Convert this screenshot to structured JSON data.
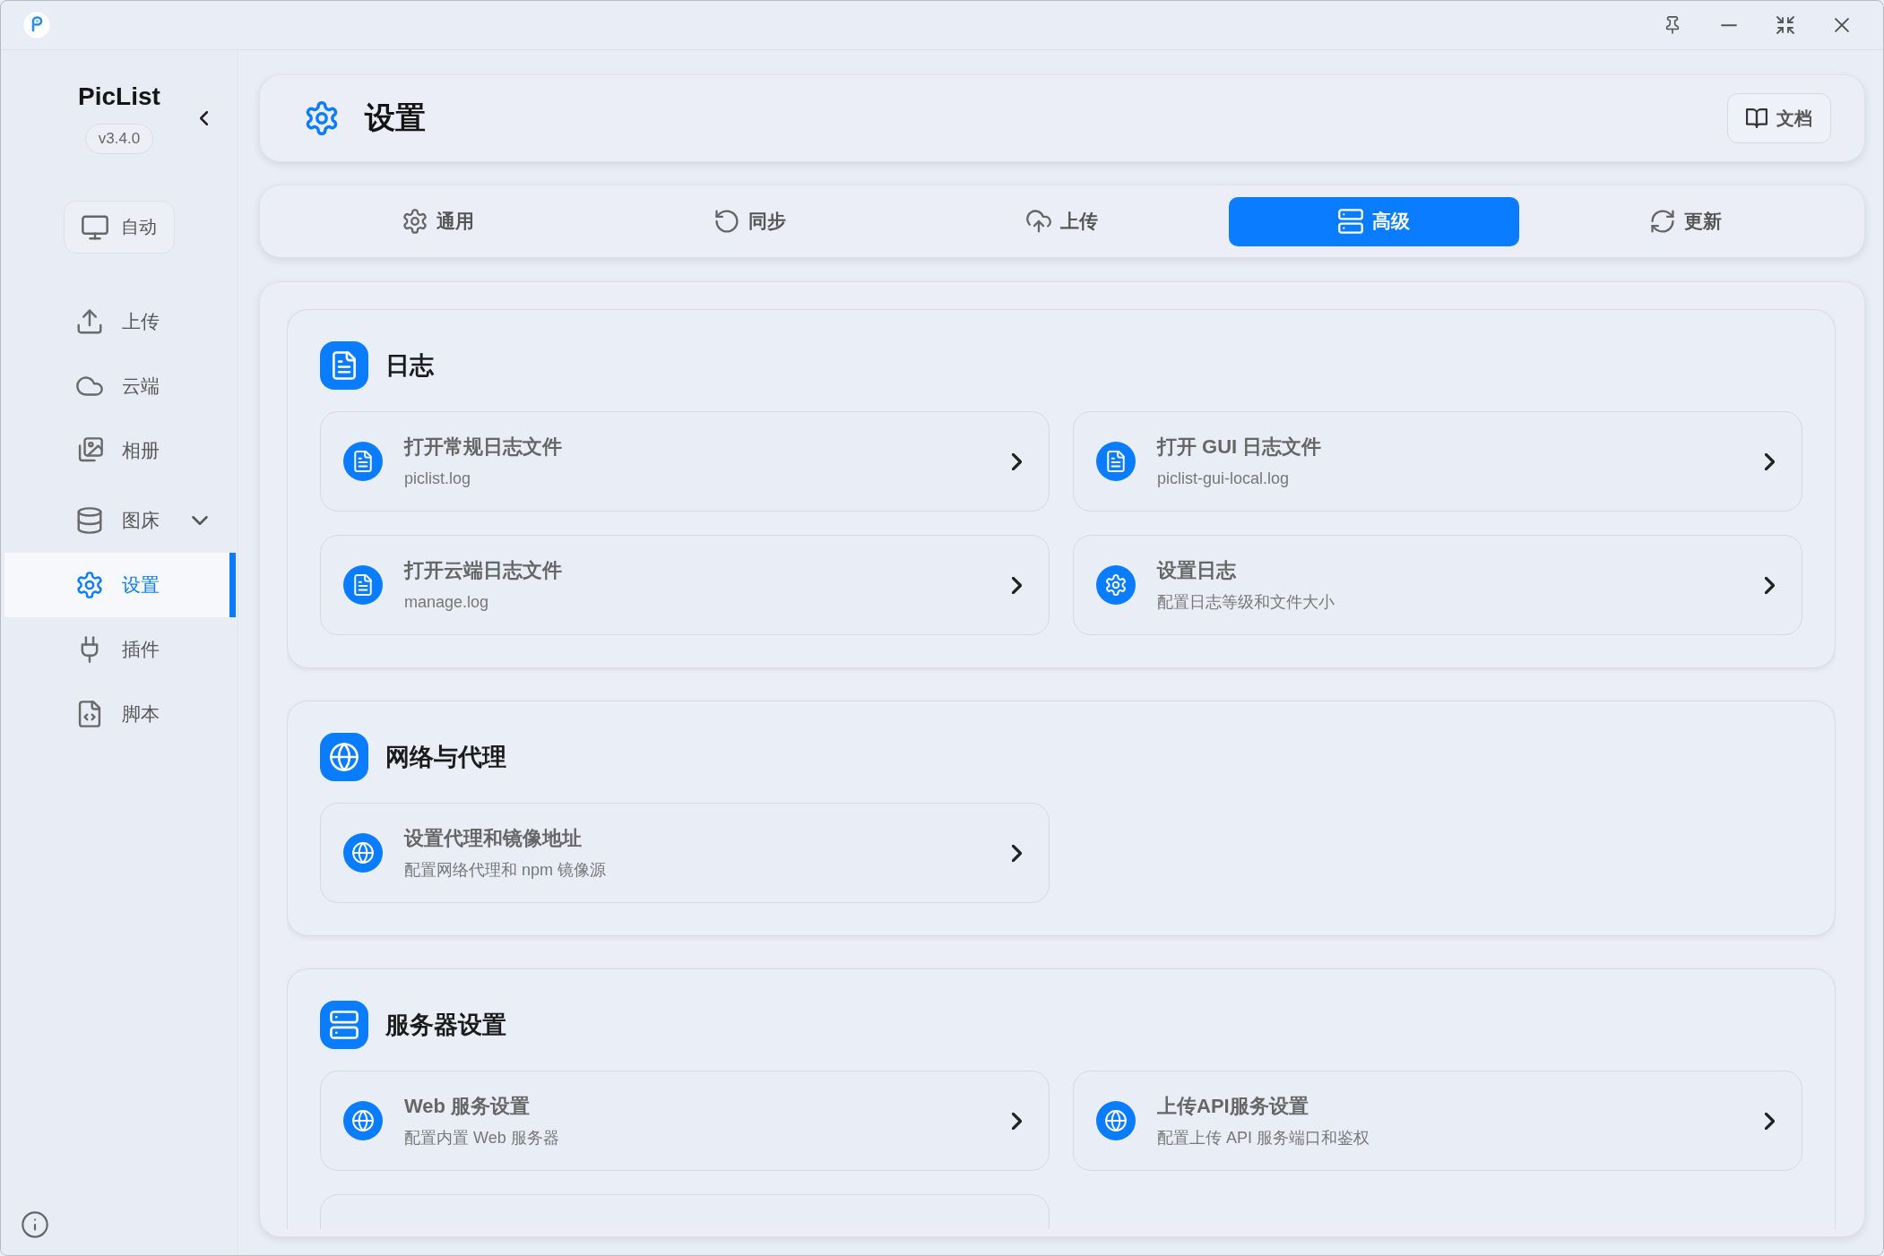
{
  "sidebar": {
    "app_name": "PicList",
    "version": "v3.4.0",
    "theme_button": "自动",
    "items": [
      {
        "label": "上传",
        "selected": false
      },
      {
        "label": "云端",
        "selected": false
      },
      {
        "label": "相册",
        "selected": false
      },
      {
        "label": "图床",
        "selected": false,
        "expanded": false
      },
      {
        "label": "设置",
        "selected": true
      },
      {
        "label": "插件",
        "selected": false
      },
      {
        "label": "脚本",
        "selected": false
      }
    ]
  },
  "header": {
    "title": "设置",
    "docs_button": "文档"
  },
  "tabs": [
    {
      "label": "通用",
      "selected": false
    },
    {
      "label": "同步",
      "selected": false
    },
    {
      "label": "上传",
      "selected": false
    },
    {
      "label": "高级",
      "selected": true
    },
    {
      "label": "更新",
      "selected": false
    }
  ],
  "sections": [
    {
      "title": "日志",
      "items": [
        {
          "title": "打开常规日志文件",
          "subtitle": "piclist.log"
        },
        {
          "title": "打开 GUI 日志文件",
          "subtitle": "piclist-gui-local.log"
        },
        {
          "title": "打开云端日志文件",
          "subtitle": "manage.log"
        },
        {
          "title": "设置日志",
          "subtitle": "配置日志等级和文件大小"
        }
      ]
    },
    {
      "title": "网络与代理",
      "items": [
        {
          "title": "设置代理和镜像地址",
          "subtitle": "配置网络代理和 npm 镜像源"
        }
      ]
    },
    {
      "title": "服务器设置",
      "items": [
        {
          "title": "Web 服务设置",
          "subtitle": "配置内置 Web 服务器"
        },
        {
          "title": "上传API服务设置",
          "subtitle": "配置上传 API 服务端口和鉴权"
        },
        {
          "cut_off": true
        }
      ]
    }
  ]
}
